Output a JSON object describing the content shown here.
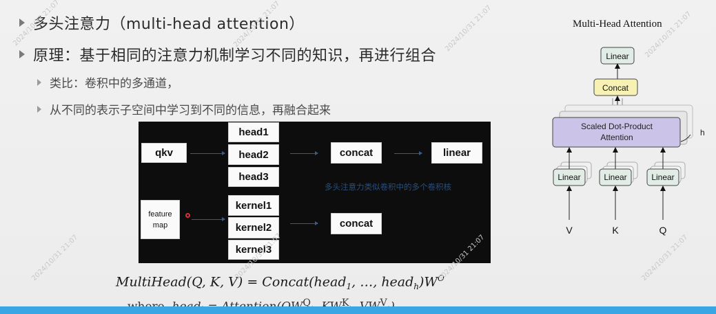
{
  "bullets": {
    "b1": "多头注意力（multi-head attention）",
    "b2": "原理：基于相同的注意力机制学习不同的知识，再进行组合",
    "b3": "类比：卷积中的多通道，",
    "b4": "从不同的表示子空间中学习到不同的信息，再融合起来"
  },
  "diagram": {
    "qkv": "qkv",
    "heads": [
      "head1",
      "head2",
      "head3"
    ],
    "concat_top": "concat",
    "linear": "linear",
    "feature_map": [
      "feature",
      "map"
    ],
    "kernels": [
      "kernel1",
      "kernel2",
      "kernel3"
    ],
    "concat_bottom": "concat",
    "note": "多头注意力类似卷积中的多个卷积核"
  },
  "formula": {
    "main": "MultiHead(Q, K, V) = Concat(head",
    "sub1": "1",
    "mid": ", …, head",
    "subh": "h",
    "end": ")W",
    "sup": "O",
    "where_label": "where,",
    "where_expr": "head",
    "where_sub": "i",
    "where_rest": "= Attention(QW",
    "where_q_sup": "Q",
    "where_q_sub": "i",
    "where_k": ", KW",
    "where_k_sup": "K",
    "where_k_sub": "i",
    "where_v": ", VW",
    "where_v_sup": "V",
    "where_v_sub": "i",
    "where_close": ")"
  },
  "figure": {
    "title": "Multi-Head Attention",
    "linear_top": "Linear",
    "concat": "Concat",
    "sdpa_line1": "Scaled Dot-Product",
    "sdpa_line2": "Attention",
    "h_label": "h",
    "linears": [
      "Linear",
      "Linear",
      "Linear"
    ],
    "inputs": [
      "V",
      "K",
      "Q"
    ]
  },
  "watermark": "2024/10/31 21:07",
  "colors": {
    "bar": "#3aa7e4",
    "sdpa_fill": "#cbc3e8",
    "concat_fill": "#f7f1b4",
    "linear_fill": "#e1ece6"
  }
}
